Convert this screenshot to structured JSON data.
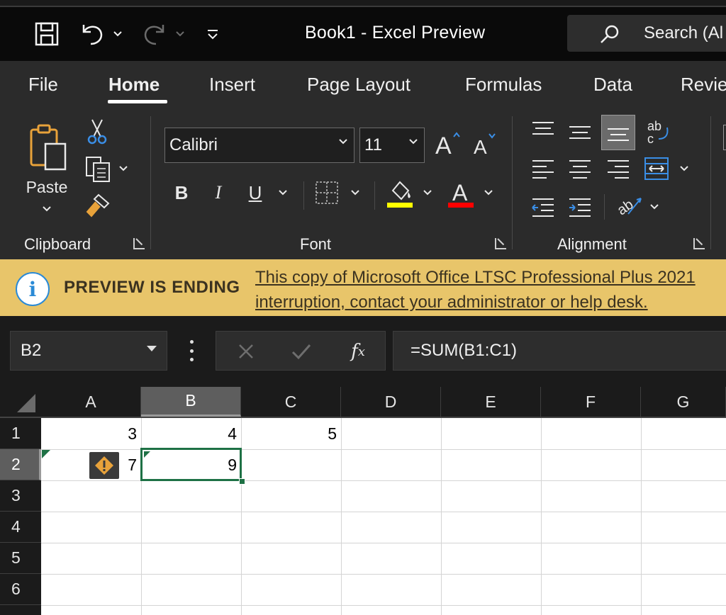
{
  "window": {
    "title": "Book1  -  Excel Preview",
    "search_label": "Search (Al"
  },
  "tabs": [
    {
      "label": "File",
      "active": false
    },
    {
      "label": "Home",
      "active": true
    },
    {
      "label": "Insert",
      "active": false
    },
    {
      "label": "Page Layout",
      "active": false
    },
    {
      "label": "Formulas",
      "active": false
    },
    {
      "label": "Data",
      "active": false
    },
    {
      "label": "Revie",
      "active": false
    }
  ],
  "ribbon": {
    "clipboard": {
      "paste_label": "Paste",
      "group_label": "Clipboard"
    },
    "font": {
      "font_name": "Calibri",
      "font_size": "11",
      "group_label": "Font",
      "bold_label": "B",
      "italic_label": "I",
      "underline_label": "U",
      "highlight_color": "#ffff00",
      "font_color": "#ff0000"
    },
    "alignment": {
      "group_label": "Alignment"
    }
  },
  "infobar": {
    "title": "PREVIEW IS ENDING",
    "message_line1": "This copy of Microsoft Office LTSC Professional Plus 2021",
    "message_line2": "interruption, contact your administrator or help desk."
  },
  "formula_bar": {
    "name_box": "B2",
    "formula": "=SUM(B1:C1)"
  },
  "sheet": {
    "columns": [
      "A",
      "B",
      "C",
      "D",
      "E",
      "F",
      "G"
    ],
    "rows": [
      "1",
      "2",
      "3",
      "4",
      "5",
      "6"
    ],
    "selected_cell": "B2",
    "cells": {
      "A1": "3",
      "B1": "4",
      "C1": "5",
      "A2": "7",
      "B2": "9"
    }
  },
  "colors": {
    "accent_green": "#1e7145",
    "infobar_bg": "#e8c56a",
    "titlebar_bg": "#0a0a0a",
    "ribbon_bg": "#2b2b2b"
  }
}
